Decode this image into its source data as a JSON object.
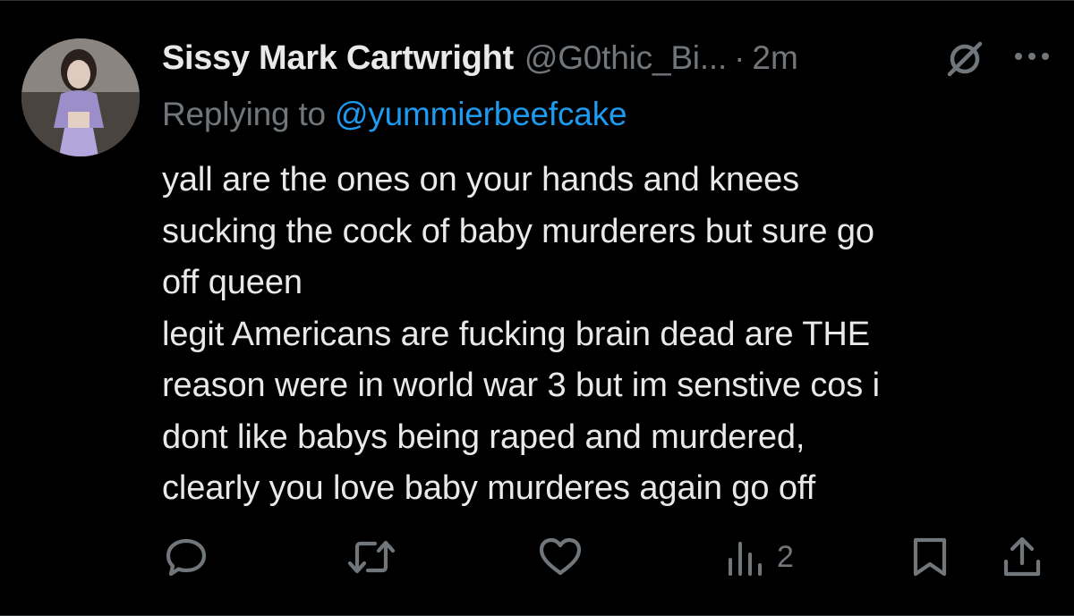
{
  "tweet": {
    "display_name": "Sissy Mark Cartwright",
    "handle": "@G0thic_Bi...",
    "separator": "·",
    "time": "2m",
    "replying_prefix": "Replying to ",
    "replying_to": "@yummierbeefcake",
    "body_lines": [
      "yall are the ones on your hands and knees",
      "sucking the cock of baby murderers but sure go",
      "off queen",
      "legit Americans are fucking brain dead are THE",
      "reason were in world war 3 but im senstive cos i",
      "dont like babys being raped and murdered,",
      "clearly you love baby murderes again go off"
    ]
  },
  "actions": {
    "views_count": "2"
  },
  "icons": {
    "reply": "reply-icon",
    "retweet": "retweet-icon",
    "like": "like-icon",
    "views": "views-icon",
    "bookmark": "bookmark-icon",
    "share": "share-icon",
    "mute": "mute-icon",
    "more": "more-icon"
  },
  "colors": {
    "background": "#000000",
    "text": "#e7e9ea",
    "secondary": "#71767b",
    "accent": "#1d9bf0"
  }
}
